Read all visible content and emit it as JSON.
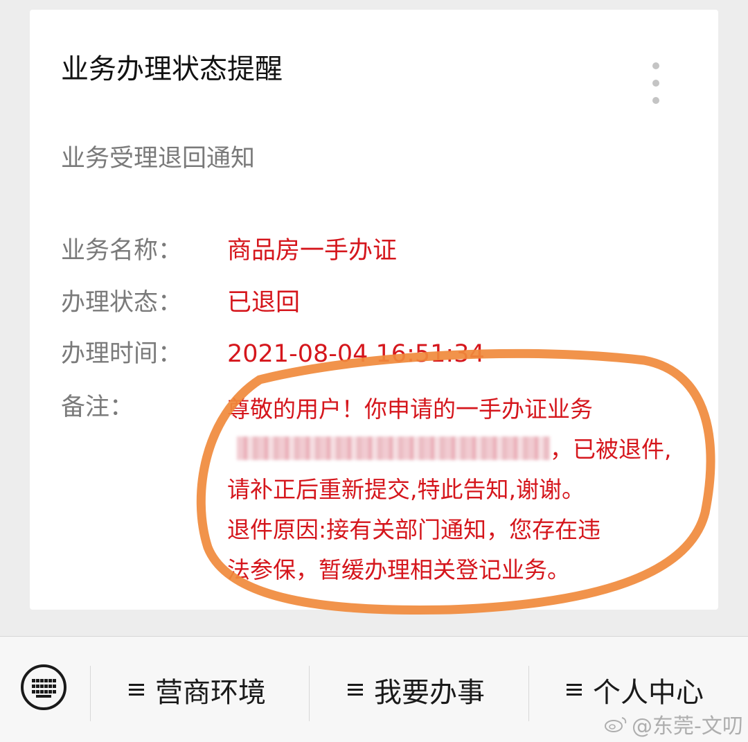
{
  "card": {
    "title": "业务办理状态提醒",
    "subtitle": "业务受理退回通知",
    "fields": [
      {
        "label": "业务名称：",
        "value": "商品房一手办证"
      },
      {
        "label": "办理状态：",
        "value": "已退回"
      },
      {
        "label": "办理时间：",
        "value": "2021-08-04 16:51:34"
      }
    ],
    "remark": {
      "label": "备注：",
      "lines": [
        "尊敬的用户！你申请的一手办证业务",
        "，已被退件,",
        "请补正后重新提交,特此告知,谢谢。",
        "退件原因:接有关部门通知，您存在违",
        "法参保，暂缓办理相关登记业务。"
      ]
    }
  },
  "menu": {
    "keyboard_icon": "keyboard-icon",
    "items": [
      {
        "label": "营商环境",
        "icon": "hamburger-icon"
      },
      {
        "label": "我要办事",
        "icon": "hamburger-icon"
      },
      {
        "label": "个人中心",
        "icon": "hamburger-icon"
      }
    ]
  },
  "watermark": {
    "text": "@东莞-文叨",
    "icon": "weibo-icon"
  },
  "colors": {
    "background": "#ededed",
    "card": "#ffffff",
    "title": "#111111",
    "label": "#7a7a7a",
    "value_red": "#d5161c",
    "annotation_orange": "#f08a3c",
    "menu_bar": "#f7f7f7"
  }
}
